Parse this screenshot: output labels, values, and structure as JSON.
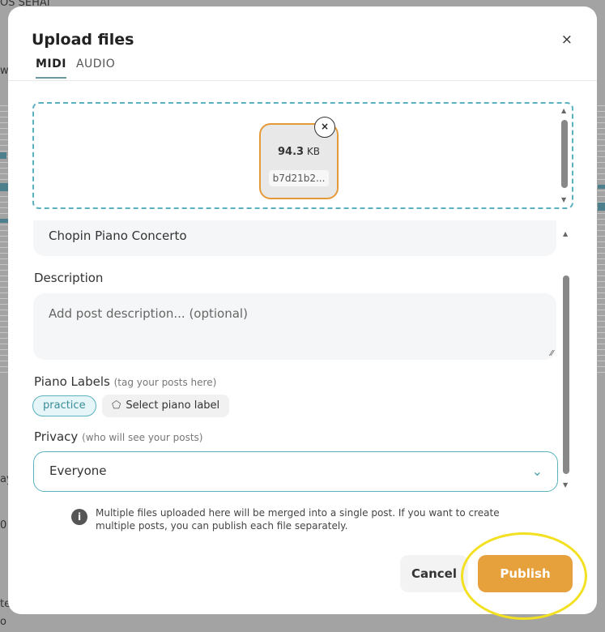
{
  "background": {
    "top_text": "OS    SEHAI",
    "left_fragment_1": "w",
    "left_fragment_2": "ay",
    "left_fragment_3": "0",
    "left_fragment_4": "te",
    "left_fragment_5": "o"
  },
  "modal": {
    "title": "Upload files",
    "close_label": "×",
    "tabs": [
      {
        "label": "MIDI",
        "active": true
      },
      {
        "label": "AUDIO",
        "active": false
      }
    ]
  },
  "file": {
    "size_value": "94.3",
    "size_unit": "KB",
    "name": "b7d21b2...",
    "remove_label": "×"
  },
  "form": {
    "title_value": "Chopin Piano Concerto",
    "description_label": "Description",
    "description_placeholder": "Add post description... (optional)",
    "labels_label": "Piano Labels",
    "labels_hint": "(tag your posts here)",
    "tag": "practice",
    "select_label": "Select piano label",
    "privacy_label": "Privacy",
    "privacy_hint": "(who will see your posts)",
    "privacy_value": "Everyone"
  },
  "info": {
    "icon_label": "i",
    "text": "Multiple files uploaded here will be merged into a single post. If you want to create multiple posts, you can publish each file separately."
  },
  "footer": {
    "cancel_label": "Cancel",
    "publish_label": "Publish"
  },
  "colors": {
    "accent_teal": "#5ab2bf",
    "accent_orange": "#e6a13d",
    "highlight": "#f2e021"
  }
}
